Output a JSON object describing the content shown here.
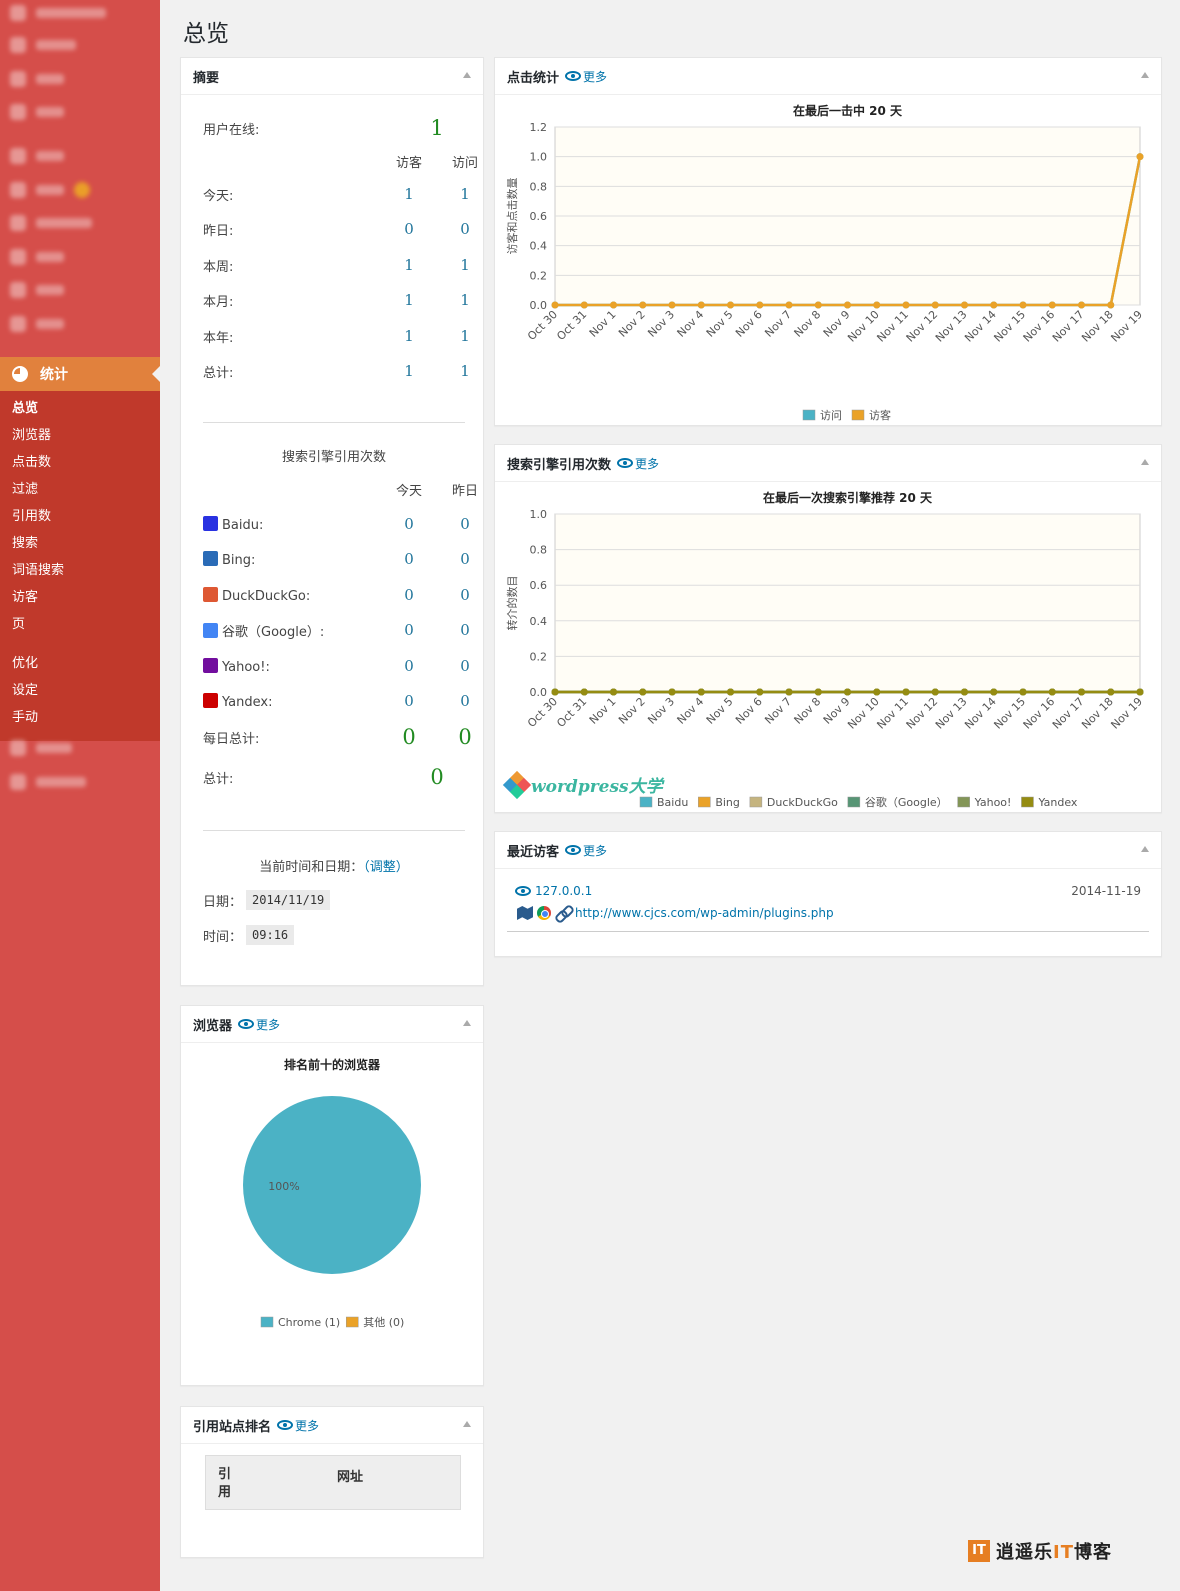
{
  "page_title": "总览",
  "sidebar": {
    "active": "统计",
    "submenu": [
      "总览",
      "浏览器",
      "点击数",
      "过滤",
      "引用数",
      "搜索",
      "词语搜索",
      "访客",
      "页"
    ],
    "submenu2": [
      "优化",
      "设定",
      "手动"
    ]
  },
  "more_label": "更多",
  "summary": {
    "title": "摘要",
    "online_label": "用户在线:",
    "online_value": "1",
    "col_visitor": "访客",
    "col_visit": "访问",
    "rows": [
      {
        "label": "今天:",
        "visitor": "1",
        "visit": "1"
      },
      {
        "label": "昨日:",
        "visitor": "0",
        "visit": "0"
      },
      {
        "label": "本周:",
        "visitor": "1",
        "visit": "1"
      },
      {
        "label": "本月:",
        "visitor": "1",
        "visit": "1"
      },
      {
        "label": "本年:",
        "visitor": "1",
        "visit": "1"
      },
      {
        "label": "总计:",
        "visitor": "1",
        "visit": "1"
      }
    ],
    "se_title": "搜索引擎引用次数",
    "col_today": "今天",
    "col_yesterday": "昨日",
    "se_rows": [
      {
        "label": "Baidu:",
        "today": "0",
        "yesterday": "0",
        "icon": "baidu-icon",
        "color": "#2932e1"
      },
      {
        "label": "Bing:",
        "today": "0",
        "yesterday": "0",
        "icon": "bing-icon",
        "color": "#2a6bb7"
      },
      {
        "label": "DuckDuckGo:",
        "today": "0",
        "yesterday": "0",
        "icon": "duckduckgo-icon",
        "color": "#de5833"
      },
      {
        "label": "谷歌（Google）:",
        "today": "0",
        "yesterday": "0",
        "icon": "google-icon",
        "color": "#4285f4"
      },
      {
        "label": "Yahoo!:",
        "today": "0",
        "yesterday": "0",
        "icon": "yahoo-icon",
        "color": "#720e9e"
      },
      {
        "label": "Yandex:",
        "today": "0",
        "yesterday": "0",
        "icon": "yandex-icon",
        "color": "#cc0000"
      }
    ],
    "daily_total_label": "每日总计:",
    "daily_today": "0",
    "daily_yesterday": "0",
    "total_label": "总计:",
    "total_value": "0",
    "datetime_label": "当前时间和日期：",
    "adjust_label": "（调整）",
    "date_label": "日期：",
    "date_value": "2014/11/19",
    "time_label": "时间：",
    "time_value": "09:16"
  },
  "hits": {
    "title": "点击统计",
    "chart_data": {
      "type": "line",
      "title": "在最后一击中 20 天",
      "ylabel": "访客和点击数量",
      "ylim": [
        0,
        1.2
      ],
      "yticks": [
        "0.0",
        "0.2",
        "0.4",
        "0.6",
        "0.8",
        "1.0",
        "1.2"
      ],
      "categories": [
        "Oct 30",
        "Oct 31",
        "Nov 1",
        "Nov 2",
        "Nov 3",
        "Nov 4",
        "Nov 5",
        "Nov 6",
        "Nov 7",
        "Nov 8",
        "Nov 9",
        "Nov 10",
        "Nov 11",
        "Nov 12",
        "Nov 13",
        "Nov 14",
        "Nov 15",
        "Nov 16",
        "Nov 17",
        "Nov 18",
        "Nov 19"
      ],
      "series": [
        {
          "name": "访问",
          "color": "#4bb2c5",
          "values": [
            0,
            0,
            0,
            0,
            0,
            0,
            0,
            0,
            0,
            0,
            0,
            0,
            0,
            0,
            0,
            0,
            0,
            0,
            0,
            0,
            1
          ]
        },
        {
          "name": "访客",
          "color": "#eaa228",
          "values": [
            0,
            0,
            0,
            0,
            0,
            0,
            0,
            0,
            0,
            0,
            0,
            0,
            0,
            0,
            0,
            0,
            0,
            0,
            0,
            0,
            1
          ]
        }
      ]
    }
  },
  "search": {
    "title": "搜索引擎引用次数",
    "chart_data": {
      "type": "line",
      "title": "在最后一次搜索引擎推荐 20 天",
      "ylabel": "转介的数目",
      "ylim": [
        0,
        1.0
      ],
      "yticks": [
        "0.0",
        "0.2",
        "0.4",
        "0.6",
        "0.8",
        "1.0"
      ],
      "categories": [
        "Oct 30",
        "Oct 31",
        "Nov 1",
        "Nov 2",
        "Nov 3",
        "Nov 4",
        "Nov 5",
        "Nov 6",
        "Nov 7",
        "Nov 8",
        "Nov 9",
        "Nov 10",
        "Nov 11",
        "Nov 12",
        "Nov 13",
        "Nov 14",
        "Nov 15",
        "Nov 16",
        "Nov 17",
        "Nov 18",
        "Nov 19"
      ],
      "series": [
        {
          "name": "Baidu",
          "color": "#4bb2c5",
          "values": [
            0,
            0,
            0,
            0,
            0,
            0,
            0,
            0,
            0,
            0,
            0,
            0,
            0,
            0,
            0,
            0,
            0,
            0,
            0,
            0,
            0
          ]
        },
        {
          "name": "Bing",
          "color": "#eaa228",
          "values": [
            0,
            0,
            0,
            0,
            0,
            0,
            0,
            0,
            0,
            0,
            0,
            0,
            0,
            0,
            0,
            0,
            0,
            0,
            0,
            0,
            0
          ]
        },
        {
          "name": "DuckDuckGo",
          "color": "#c5b47f",
          "values": [
            0,
            0,
            0,
            0,
            0,
            0,
            0,
            0,
            0,
            0,
            0,
            0,
            0,
            0,
            0,
            0,
            0,
            0,
            0,
            0,
            0
          ]
        },
        {
          "name": "谷歌（Google）",
          "color": "#579575",
          "values": [
            0,
            0,
            0,
            0,
            0,
            0,
            0,
            0,
            0,
            0,
            0,
            0,
            0,
            0,
            0,
            0,
            0,
            0,
            0,
            0,
            0
          ]
        },
        {
          "name": "Yahoo!",
          "color": "#839557",
          "values": [
            0,
            0,
            0,
            0,
            0,
            0,
            0,
            0,
            0,
            0,
            0,
            0,
            0,
            0,
            0,
            0,
            0,
            0,
            0,
            0,
            0
          ]
        },
        {
          "name": "Yandex",
          "color": "#958c12",
          "values": [
            0,
            0,
            0,
            0,
            0,
            0,
            0,
            0,
            0,
            0,
            0,
            0,
            0,
            0,
            0,
            0,
            0,
            0,
            0,
            0,
            0
          ]
        }
      ]
    }
  },
  "recent": {
    "title": "最近访客",
    "ip": "127.0.0.1",
    "date": "2014-11-19",
    "url": "http://www.cjcs.com/wp-admin/plugins.php"
  },
  "browsers": {
    "title": "浏览器",
    "chart_data": {
      "type": "pie",
      "title": "排名前十的浏览器",
      "slices": [
        {
          "name": "Chrome (1)",
          "value": 1,
          "color": "#4bb2c5",
          "label": "100%"
        },
        {
          "name": "其他 (0)",
          "value": 0,
          "color": "#eaa228",
          "label": ""
        }
      ]
    }
  },
  "referrers": {
    "title": "引用站点排名",
    "col_ref": "引用",
    "col_url": "网址"
  },
  "watermarks": {
    "wp": "wordpress大学",
    "it_logo": "IT",
    "it_pre": "逍遥乐",
    "it_mid": "IT",
    "it_post": "博客"
  }
}
